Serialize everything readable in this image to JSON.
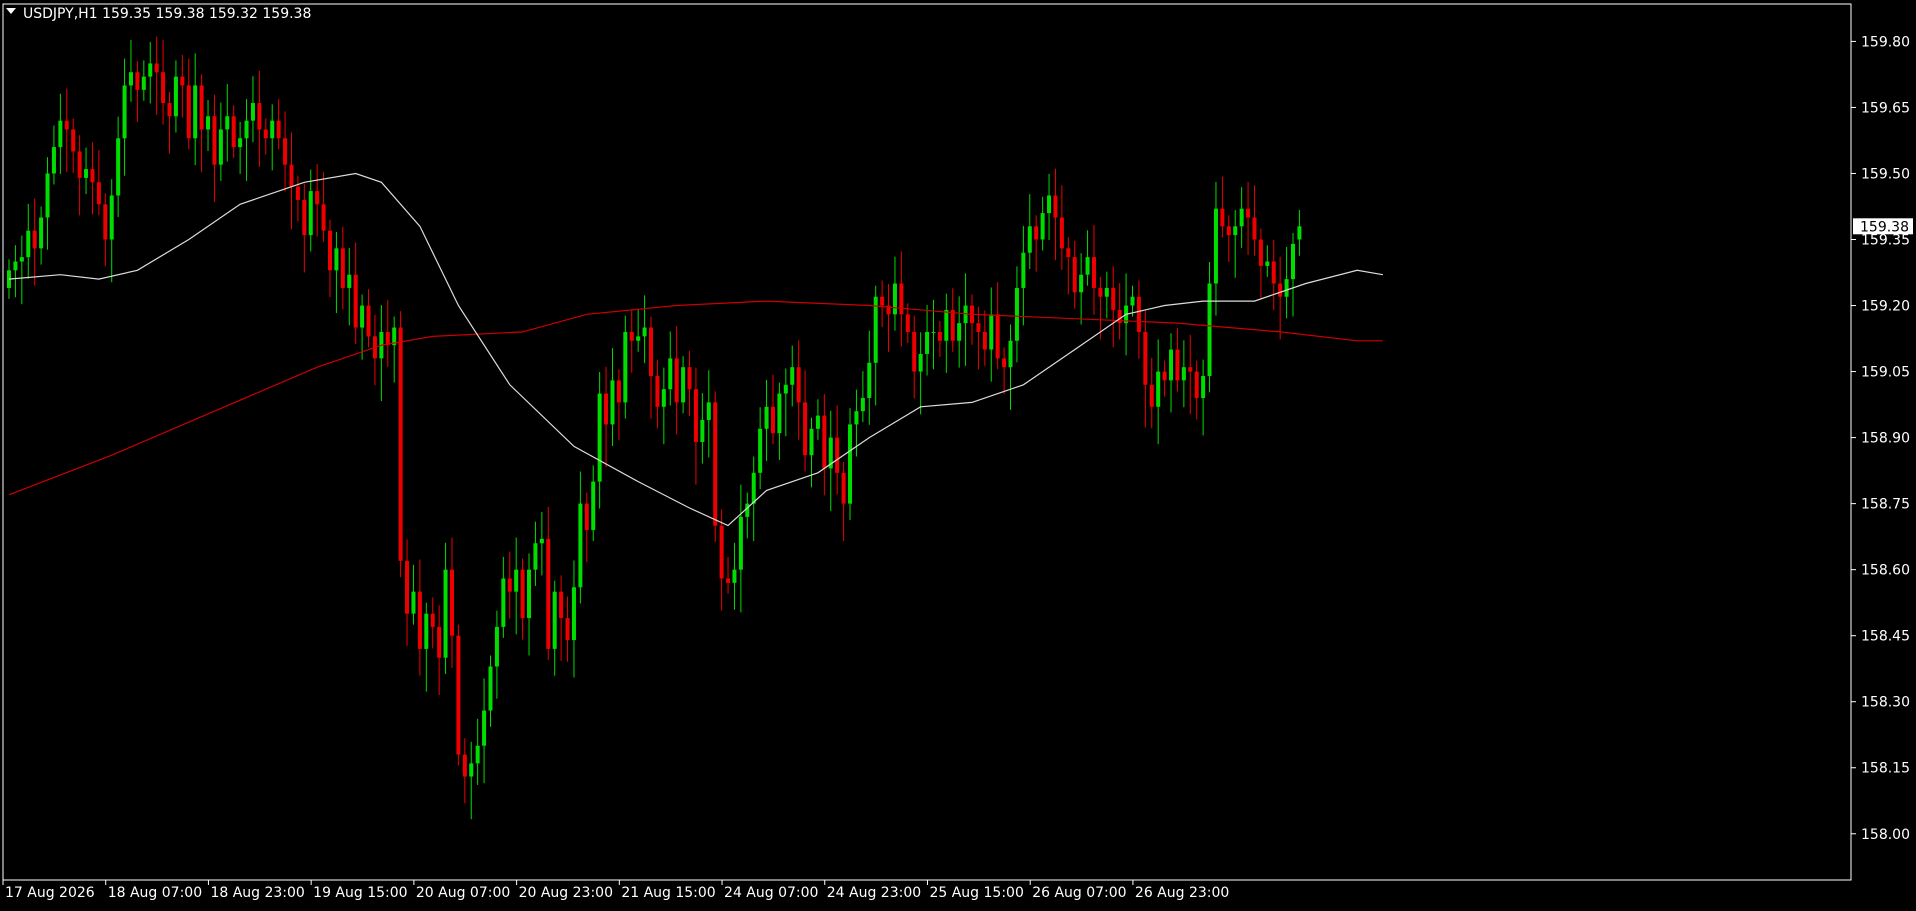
{
  "chart_data": {
    "type": "candlestick",
    "symbol": "USDJPY",
    "timeframe": "H1",
    "header": "USDJPY,H1  159.35 159.38 159.32 159.38",
    "ohlc_display": {
      "open": 159.35,
      "high": 159.38,
      "low": 159.32,
      "close": 159.38
    },
    "last_price_label": "159.38",
    "colors": {
      "background": "#000000",
      "up": "#00dd00",
      "down": "#ee0000",
      "fast_ma": "#dcdcdc",
      "slow_ma": "#cc0000",
      "frame": "#ffffff",
      "text": "#ffffff",
      "price_tag_bg": "#ffffff",
      "price_tag_text": "#000000"
    },
    "yticks": [
      159.8,
      159.65,
      159.5,
      159.35,
      159.2,
      159.05,
      158.9,
      158.75,
      158.6,
      158.45,
      158.3,
      158.15,
      158.0
    ],
    "ytick_labels": [
      "159.80",
      "159.65",
      "159.50",
      "159.35",
      "159.20",
      "159.05",
      "158.90",
      "158.75",
      "158.60",
      "158.45",
      "158.30",
      "158.15",
      "158.00"
    ],
    "ylim": [
      157.895,
      159.885
    ],
    "xtick_labels": [
      "17 Aug 2026",
      "18 Aug 07:00",
      "18 Aug 23:00",
      "19 Aug 15:00",
      "20 Aug 07:00",
      "20 Aug 23:00",
      "21 Aug 15:00",
      "24 Aug 07:00",
      "24 Aug 23:00",
      "25 Aug 15:00",
      "26 Aug 07:00",
      "26 Aug 23:00"
    ],
    "xtick_index": [
      0,
      16,
      32,
      48,
      64,
      80,
      96,
      112,
      128,
      144,
      160,
      176
    ],
    "bar_count": 184,
    "candles_close": [
      159.28,
      159.3,
      159.31,
      159.37,
      159.33,
      159.4,
      159.5,
      159.56,
      159.62,
      159.6,
      159.55,
      159.49,
      159.51,
      159.48,
      159.43,
      159.35,
      159.45,
      159.58,
      159.7,
      159.73,
      159.69,
      159.72,
      159.75,
      159.73,
      159.66,
      159.63,
      159.72,
      159.7,
      159.58,
      159.7,
      159.6,
      159.63,
      159.52,
      159.6,
      159.63,
      159.56,
      159.58,
      159.62,
      159.66,
      159.6,
      159.58,
      159.62,
      159.58,
      159.52,
      159.47,
      159.44,
      159.36,
      159.46,
      159.43,
      159.37,
      159.28,
      159.33,
      159.24,
      159.27,
      159.15,
      159.2,
      159.13,
      159.08,
      159.14,
      159.11,
      159.15,
      158.62,
      158.5,
      158.55,
      158.42,
      158.5,
      158.47,
      158.4,
      158.6,
      158.45,
      158.18,
      158.13,
      158.16,
      158.2,
      158.28,
      158.38,
      158.47,
      158.58,
      158.55,
      158.6,
      158.49,
      158.6,
      158.66,
      158.67,
      158.42,
      158.55,
      158.49,
      158.44,
      158.56,
      158.75,
      158.69,
      158.8,
      159.0,
      158.93,
      159.03,
      158.98,
      159.14,
      159.12,
      159.13,
      159.15,
      159.04,
      158.97,
      159.01,
      159.08,
      158.98,
      159.06,
      159.01,
      158.89,
      158.94,
      158.98,
      158.7,
      158.58,
      158.57,
      158.6,
      158.72,
      158.75,
      158.82,
      158.92,
      158.97,
      158.91,
      159.0,
      159.02,
      159.06,
      158.98,
      158.86,
      158.92,
      158.95,
      158.83,
      158.9,
      158.82,
      158.75,
      158.93,
      158.96,
      158.99,
      159.07,
      159.22,
      159.2,
      159.18,
      159.25,
      159.18,
      159.14,
      159.05,
      159.09,
      159.14,
      159.14,
      159.12,
      159.19,
      159.12,
      159.16,
      159.2,
      159.16,
      159.14,
      159.1,
      159.18,
      159.08,
      159.06,
      159.12,
      159.24,
      159.32,
      159.38,
      159.35,
      159.41,
      159.45,
      159.4,
      159.33,
      159.31,
      159.23,
      159.27,
      159.31,
      159.24,
      159.22,
      159.24,
      159.19,
      159.16,
      159.2,
      159.22,
      159.14,
      159.02,
      158.97,
      159.05,
      159.03,
      159.1,
      159.03,
      159.06,
      159.05,
      158.99,
      159.04,
      159.25,
      159.42,
      159.38,
      159.36,
      159.38,
      159.42,
      159.4,
      159.35,
      159.29,
      159.3,
      159.25,
      159.22,
      159.26,
      159.34,
      159.38
    ],
    "candles_open": [
      159.24,
      159.28,
      159.3,
      159.31,
      159.37,
      159.33,
      159.4,
      159.5,
      159.56,
      159.62,
      159.6,
      159.55,
      159.49,
      159.51,
      159.48,
      159.43,
      159.35,
      159.45,
      159.58,
      159.7,
      159.73,
      159.69,
      159.72,
      159.75,
      159.73,
      159.66,
      159.63,
      159.72,
      159.7,
      159.58,
      159.7,
      159.6,
      159.63,
      159.52,
      159.6,
      159.63,
      159.56,
      159.58,
      159.62,
      159.66,
      159.6,
      159.58,
      159.62,
      159.58,
      159.52,
      159.47,
      159.44,
      159.36,
      159.46,
      159.43,
      159.37,
      159.28,
      159.33,
      159.24,
      159.27,
      159.15,
      159.2,
      159.13,
      159.08,
      159.14,
      159.11,
      159.15,
      158.62,
      158.5,
      158.55,
      158.42,
      158.5,
      158.47,
      158.4,
      158.6,
      158.45,
      158.18,
      158.13,
      158.16,
      158.2,
      158.28,
      158.38,
      158.47,
      158.58,
      158.55,
      158.6,
      158.49,
      158.6,
      158.66,
      158.67,
      158.42,
      158.55,
      158.49,
      158.44,
      158.56,
      158.75,
      158.69,
      158.8,
      159.0,
      158.93,
      159.03,
      158.98,
      159.14,
      159.12,
      159.13,
      159.15,
      159.04,
      158.97,
      159.01,
      159.08,
      158.98,
      159.06,
      159.01,
      158.89,
      158.94,
      158.98,
      158.7,
      158.58,
      158.57,
      158.6,
      158.72,
      158.75,
      158.82,
      158.92,
      158.97,
      158.91,
      159.0,
      159.02,
      159.06,
      158.98,
      158.86,
      158.92,
      158.95,
      158.83,
      158.9,
      158.82,
      158.75,
      158.93,
      158.96,
      158.99,
      159.07,
      159.22,
      159.2,
      159.18,
      159.25,
      159.18,
      159.14,
      159.05,
      159.09,
      159.14,
      159.14,
      159.12,
      159.19,
      159.12,
      159.16,
      159.2,
      159.16,
      159.14,
      159.1,
      159.18,
      159.08,
      159.06,
      159.12,
      159.24,
      159.32,
      159.38,
      159.35,
      159.41,
      159.45,
      159.4,
      159.33,
      159.31,
      159.23,
      159.27,
      159.31,
      159.24,
      159.22,
      159.24,
      159.19,
      159.16,
      159.2,
      159.22,
      159.14,
      159.02,
      158.97,
      159.05,
      159.03,
      159.1,
      159.03,
      159.06,
      159.05,
      158.99,
      159.04,
      159.25,
      159.42,
      159.38,
      159.36,
      159.38,
      159.42,
      159.4,
      159.35,
      159.29,
      159.3,
      159.25,
      159.22,
      159.26,
      159.35
    ],
    "fast_ma": [
      [
        0,
        159.26
      ],
      [
        8,
        159.27
      ],
      [
        14,
        159.26
      ],
      [
        20,
        159.28
      ],
      [
        28,
        159.35
      ],
      [
        36,
        159.43
      ],
      [
        46,
        159.48
      ],
      [
        54,
        159.5
      ],
      [
        58,
        159.48
      ],
      [
        64,
        159.38
      ],
      [
        70,
        159.2
      ],
      [
        78,
        159.02
      ],
      [
        88,
        158.88
      ],
      [
        98,
        158.8
      ],
      [
        106,
        158.74
      ],
      [
        112,
        158.7
      ],
      [
        118,
        158.78
      ],
      [
        126,
        158.82
      ],
      [
        134,
        158.9
      ],
      [
        142,
        158.97
      ],
      [
        150,
        158.98
      ],
      [
        158,
        159.02
      ],
      [
        166,
        159.1
      ],
      [
        174,
        159.18
      ],
      [
        180,
        159.2
      ],
      [
        186,
        159.21
      ],
      [
        194,
        159.21
      ],
      [
        202,
        159.25
      ],
      [
        210,
        159.28
      ],
      [
        214,
        159.27
      ]
    ],
    "slow_ma": [
      [
        0,
        158.77
      ],
      [
        16,
        158.86
      ],
      [
        32,
        158.96
      ],
      [
        48,
        159.06
      ],
      [
        58,
        159.11
      ],
      [
        66,
        159.13
      ],
      [
        80,
        159.14
      ],
      [
        90,
        159.18
      ],
      [
        104,
        159.2
      ],
      [
        118,
        159.21
      ],
      [
        134,
        159.2
      ],
      [
        150,
        159.18
      ],
      [
        166,
        159.17
      ],
      [
        182,
        159.16
      ],
      [
        198,
        159.14
      ],
      [
        210,
        159.12
      ],
      [
        214,
        159.12
      ]
    ]
  }
}
